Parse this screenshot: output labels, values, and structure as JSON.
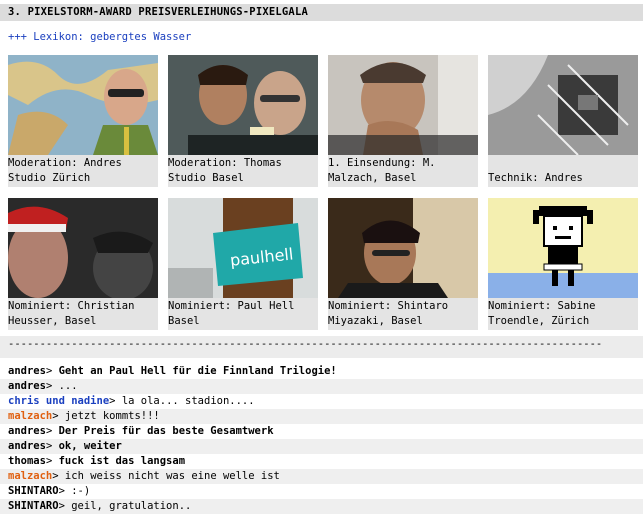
{
  "title": "3. PIXELSTORM-AWARD PREISVERLEIHUNGS-PIXELGALA",
  "lexikon": "+++ Lexikon: gebergtes Wasser",
  "colors": {
    "title_bg": "#dcdcdc",
    "link_blue": "#1a3fbf",
    "nick_orange": "#e06010",
    "nick_black": "#000000",
    "card_bg": "#e4e4e4"
  },
  "cards": [
    {
      "caption": "Moderation: Andres Studio Zürich",
      "icon": "world-map-portrait"
    },
    {
      "caption": "Moderation: Thomas Studio Basel",
      "icon": "two-men-portrait"
    },
    {
      "caption": "1. Einsendung: M. Malzach, Basel",
      "icon": "thinking-man-portrait"
    },
    {
      "caption": "\nTechnik: Andres",
      "icon": "tech-setup-photo"
    },
    {
      "caption": "Nominiert: Christian Heusser, Basel",
      "icon": "red-beanie-portrait"
    },
    {
      "caption": "Nominiert: Paul Hell Basel",
      "icon": "paulhell-bottle-photo"
    },
    {
      "caption": "Nominiert: Shintaro Miyazaki, Basel",
      "icon": "glasses-man-portrait"
    },
    {
      "caption": "Nominiert: Sabine Troendle, Zürich",
      "icon": "pixel-girl-illustration"
    }
  ],
  "divider": "----------------------------------------------------------------------------------------------",
  "chat": [
    {
      "nick": "andres",
      "nick_color": "#000000",
      "msg": "Geht an Paul Hell für die Finnland Trilogie!",
      "msg_bold": true
    },
    {
      "nick": "andres",
      "nick_color": "#000000",
      "msg": "...",
      "msg_bold": false
    },
    {
      "nick": "chris und nadine",
      "nick_color": "#1a3fbf",
      "msg": "la ola... stadion....",
      "msg_bold": false
    },
    {
      "nick": "malzach",
      "nick_color": "#e06010",
      "msg": "jetzt kommts!!!",
      "msg_bold": false
    },
    {
      "nick": "andres",
      "nick_color": "#000000",
      "msg": "Der Preis für das beste Gesamtwerk",
      "msg_bold": true
    },
    {
      "nick": "andres",
      "nick_color": "#000000",
      "msg": "ok, weiter",
      "msg_bold": true
    },
    {
      "nick": "thomas",
      "nick_color": "#000000",
      "msg": "fuck ist das langsam",
      "msg_bold": true
    },
    {
      "nick": "malzach",
      "nick_color": "#e06010",
      "msg": "ich weiss nicht was eine welle ist",
      "msg_bold": false
    },
    {
      "nick": "SHINTARO",
      "nick_color": "#000000",
      "msg": ":-)",
      "msg_bold": false
    },
    {
      "nick": "SHINTARO",
      "nick_color": "#000000",
      "msg": "geil, gratulation..",
      "msg_bold": false
    }
  ]
}
